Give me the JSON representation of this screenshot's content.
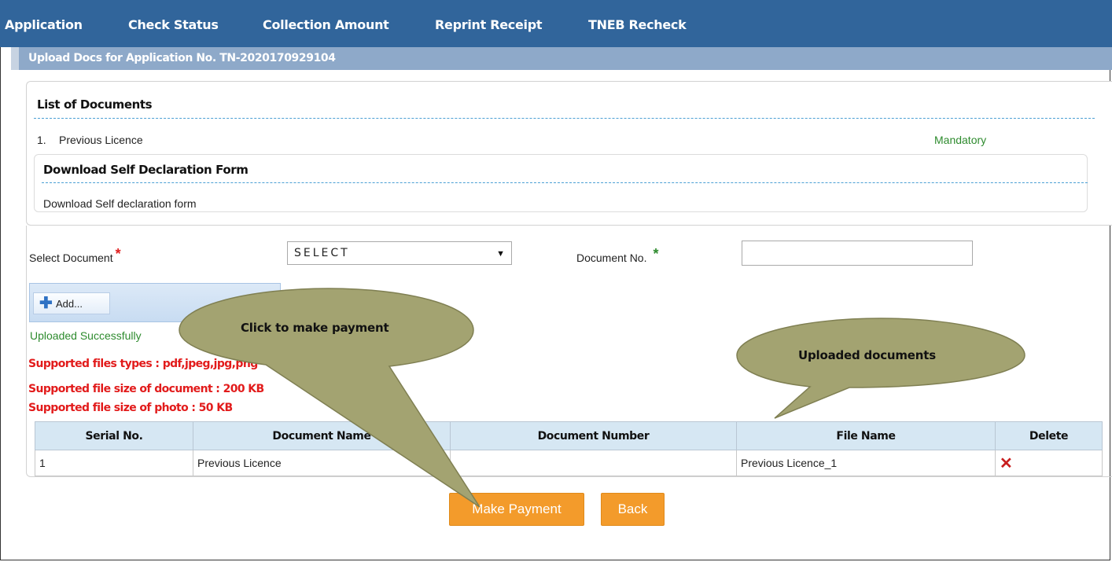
{
  "nav": {
    "items": [
      "Application",
      "Check Status",
      "Collection Amount",
      "Reprint Receipt",
      "TNEB Recheck"
    ]
  },
  "subheader": {
    "title": "Upload Docs for Application No. TN-2020170929104"
  },
  "documents": {
    "title": "List of Documents",
    "items": [
      {
        "num": "1.",
        "name": "Previous Licence",
        "status": "Mandatory"
      }
    ]
  },
  "self_declaration": {
    "title": "Download Self Declaration Form",
    "link": "Download Self declaration form"
  },
  "form": {
    "select_label": "Select Document",
    "select_value": "SELECT",
    "docno_label": "Document No.",
    "docno_value": "",
    "required_mark": "*"
  },
  "upload": {
    "add_label": "Add...",
    "status": "Uploaded Successfully"
  },
  "requirements": [
    "Supported files types : pdf,jpeg,jpg,png",
    "Supported file size of document : 200 KB",
    "Supported file size of photo : 50 KB"
  ],
  "table": {
    "headers": [
      "Serial No.",
      "Document Name",
      "Document Number",
      "File Name",
      "Delete"
    ],
    "rows": [
      {
        "serial": "1",
        "doc_name": "Previous Licence",
        "doc_number": "",
        "file_name": "Previous Licence_1",
        "delete_icon": "✕"
      }
    ]
  },
  "buttons": {
    "make_payment": "Make Payment",
    "back": "Back"
  },
  "callouts": {
    "payment": "Click to make payment",
    "uploaded": "Uploaded documents",
    "fill_color": "#a3a371"
  },
  "icons": {
    "plus": "plus-icon",
    "delete": "delete-x-icon",
    "dropdown": "chevron-down-icon"
  },
  "colors": {
    "nav_bg": "#31659b",
    "subheader_bg": "#8ea9c9",
    "button_orange": "#f39b2b",
    "mandatory_green": "#2e8b2e",
    "required_red": "#e21b1b"
  }
}
